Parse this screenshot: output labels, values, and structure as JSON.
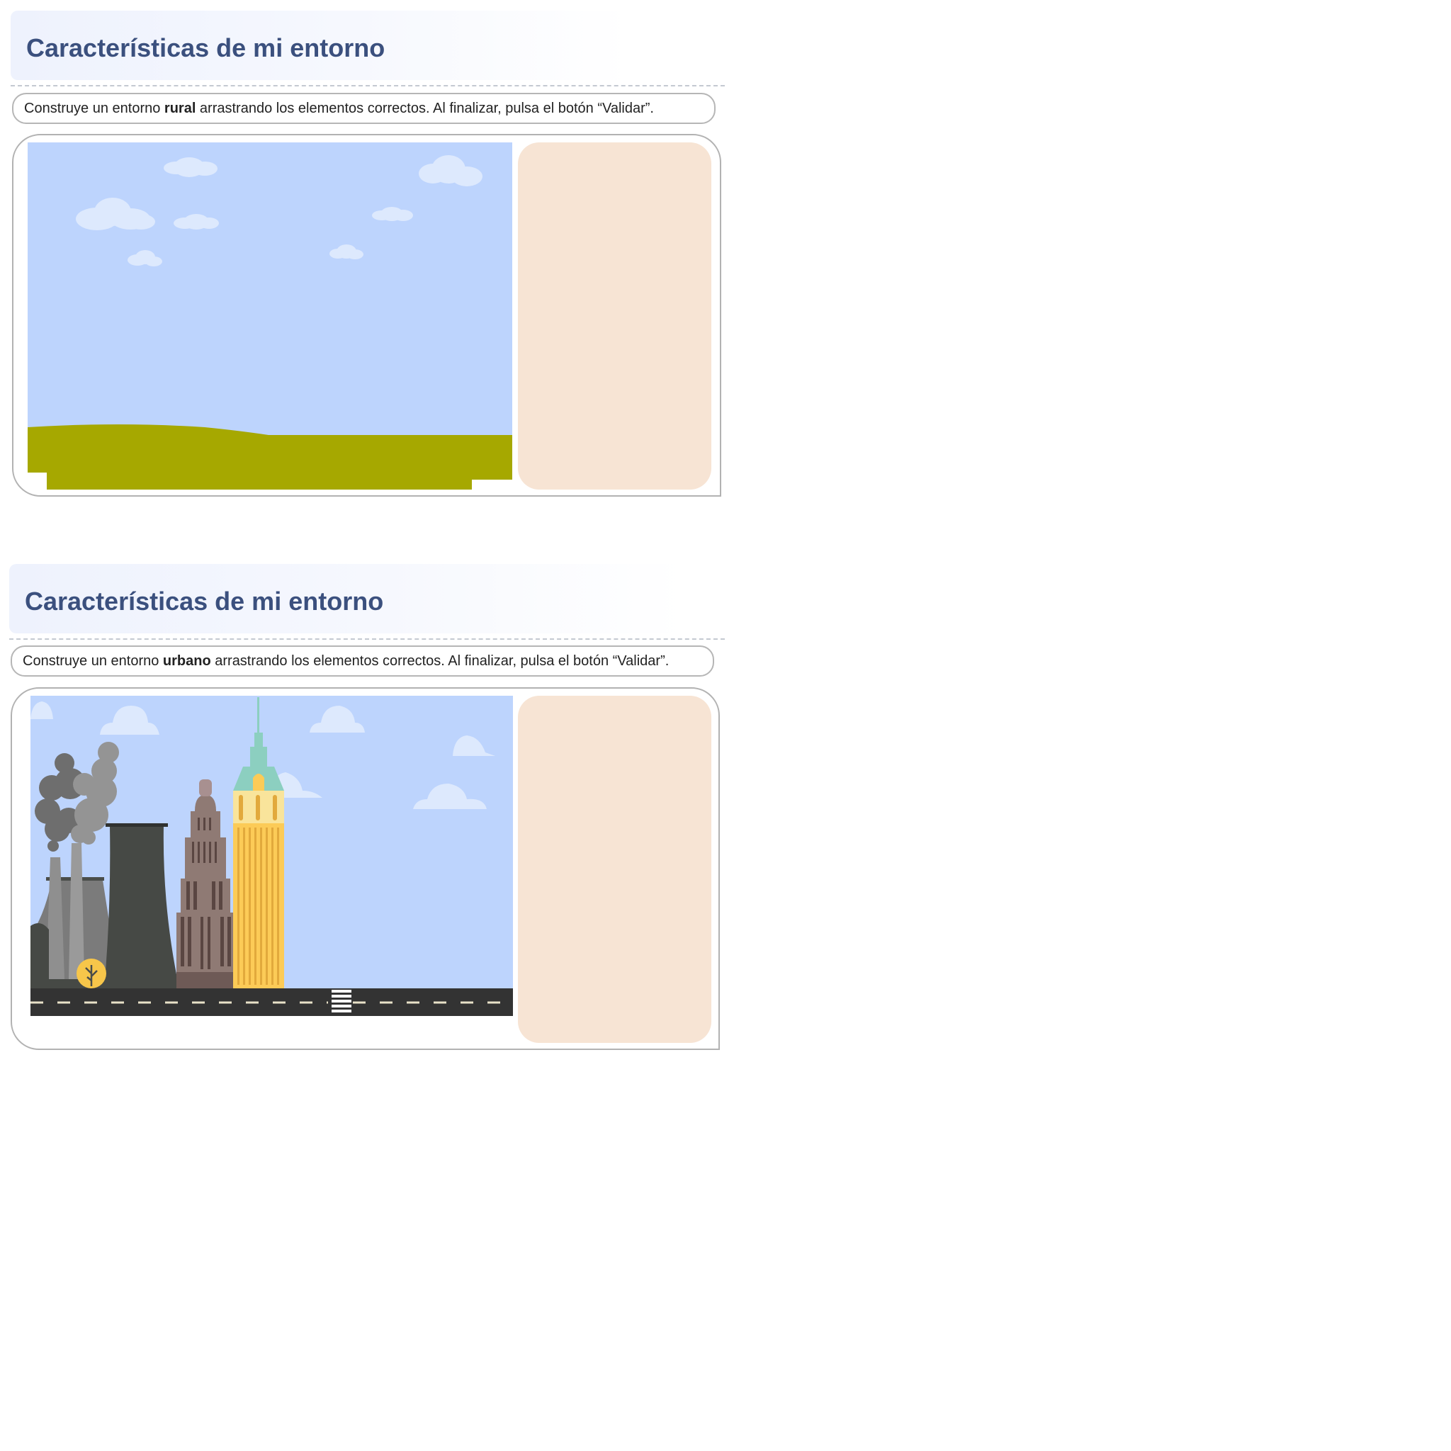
{
  "activities": [
    {
      "title": "Características de mi entorno",
      "instruction": {
        "before": "Construye un entorno ",
        "keyword": "rural",
        "after": " arrastrando los elementos correctos. Al finalizar, pulsa el botón “Validar”."
      },
      "scene": "rural-landscape",
      "tray": "elements-tray"
    },
    {
      "title": "Características de mi entorno",
      "instruction": {
        "before": "Construye un entorno ",
        "keyword": "urbano",
        "after": " arrastrando los elementos correctos. Al finalizar, pulsa el botón “Validar”."
      },
      "scene": "urban-cityscape",
      "tray": "elements-tray"
    }
  ],
  "colors": {
    "title": "#3b507e",
    "sky": "#bdd4fd",
    "grass": "#a6a800",
    "tray": "#f7e4d4",
    "road": "#333333",
    "cloud": "#dde9fd"
  }
}
